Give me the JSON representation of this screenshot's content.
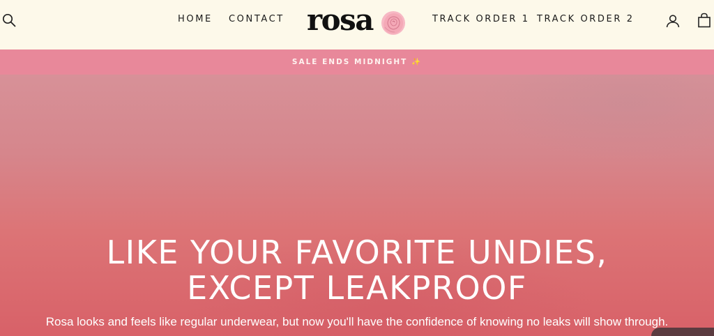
{
  "header": {
    "search_icon": "search-icon",
    "nav_left": [
      "HOME",
      "CONTACT"
    ],
    "logo_text": "rosa",
    "logo_icon": "rose-icon",
    "nav_right": [
      "TRACK ORDER 1",
      "TRACK ORDER 2"
    ],
    "account_icon": "user-icon",
    "cart_icon": "shopping-bag-icon"
  },
  "announcement": {
    "text": "SALE ENDS MIDNIGHT ✨"
  },
  "hero": {
    "headline_line1": "LIKE YOUR FAVORITE UNDIES,",
    "headline_line2": "EXCEPT LEAKPROOF",
    "subtext": "Rosa looks and feels like regular underwear, but now you'll have the confidence of knowing no leaks will show through."
  },
  "colors": {
    "header_bg": "#fdf9ea",
    "announcement_bg": "#e8889a",
    "hero_top": "#d79198",
    "hero_bottom": "#d86168",
    "text_dark": "#1a1a1a"
  }
}
